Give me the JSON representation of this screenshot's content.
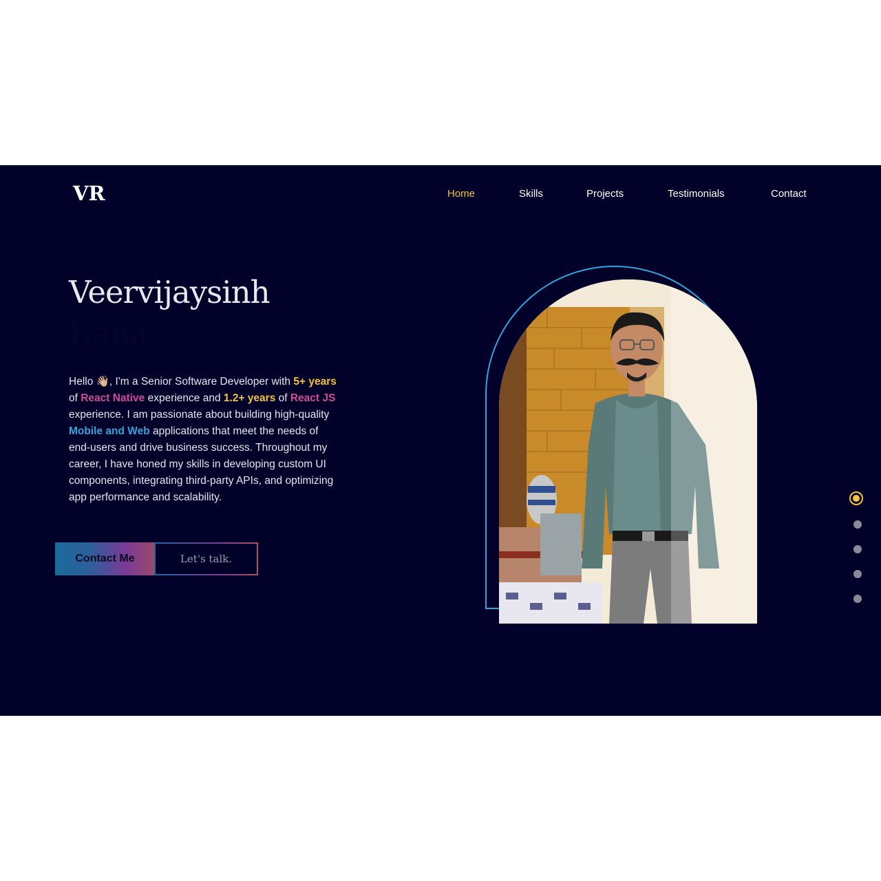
{
  "header": {
    "logo": "VR",
    "nav": [
      {
        "label": "Home",
        "active": true
      },
      {
        "label": "Skills",
        "active": false
      },
      {
        "label": "Projects",
        "active": false
      },
      {
        "label": "Testimonials",
        "active": false
      },
      {
        "label": "Contact",
        "active": false
      }
    ]
  },
  "hero": {
    "first_name": "Veervijaysinh",
    "last_name": "Rana",
    "bio": {
      "p1": "Hello 👋🏼, I'm a Senior Software Developer with ",
      "h1": "5+ years",
      "p2": " of ",
      "h2": "React Native",
      "p3": " experience and ",
      "h3": "1.2+ years",
      "p4": " of ",
      "h4": "React JS",
      "p5": " experience. I am passionate about building high-quality ",
      "h5": "Mobile and Web",
      "p6": " applications that meet the needs of end-users and drive business success. Throughout my career, I have honed my skills in developing custom UI components, integrating third-party APIs, and optimizing app performance and scalability."
    },
    "primary_button": "Contact Me",
    "secondary_button": "Let's talk.",
    "photo_icon": "person-portrait-photo"
  },
  "pager": {
    "count": 5,
    "active_index": 0
  },
  "colors": {
    "background": "#01012a",
    "accent_yellow": "#f4c33d",
    "accent_pink": "#d24a97",
    "accent_blue": "#2fa6dc"
  }
}
